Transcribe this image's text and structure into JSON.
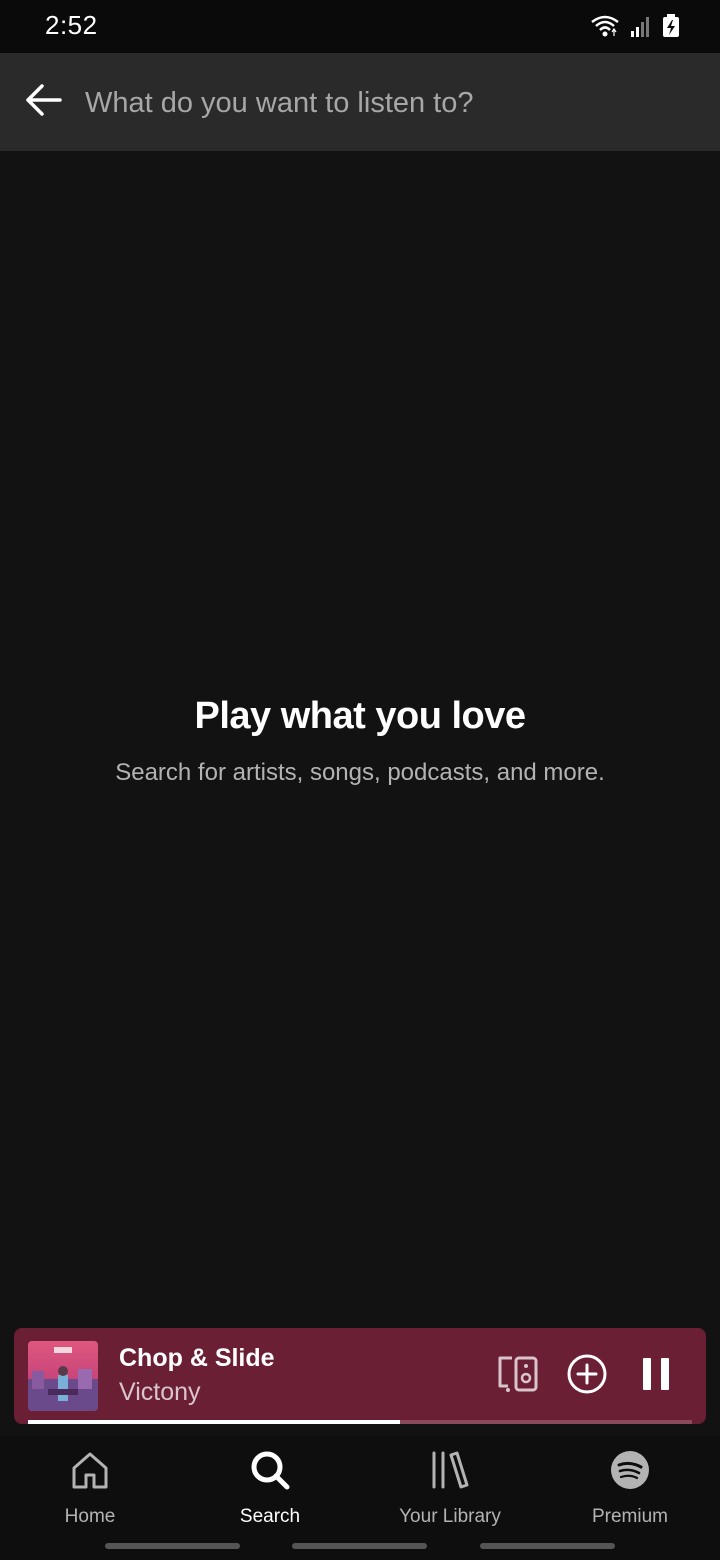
{
  "status_bar": {
    "time": "2:52",
    "icons": [
      "wifi-icon",
      "signal-icon",
      "battery-charging-icon"
    ]
  },
  "search": {
    "placeholder": "What do you want to listen to?",
    "value": ""
  },
  "empty_state": {
    "title": "Play what you love",
    "subtitle": "Search for artists, songs, podcasts, and more."
  },
  "now_playing": {
    "title": "Chop & Slide",
    "artist": "Victony",
    "progress": 0.56,
    "background_color": "#6b1f35",
    "controls": [
      "devices-icon",
      "add-icon",
      "pause-icon"
    ]
  },
  "nav": {
    "items": [
      {
        "label": "Home",
        "icon": "home-icon",
        "active": false
      },
      {
        "label": "Search",
        "icon": "search-icon",
        "active": true
      },
      {
        "label": "Your Library",
        "icon": "library-icon",
        "active": false
      },
      {
        "label": "Premium",
        "icon": "spotify-icon",
        "active": false
      }
    ]
  },
  "colors": {
    "background": "#121212",
    "header": "#2a2a2a",
    "text_primary": "#ffffff",
    "text_secondary": "#b3b3b3"
  }
}
